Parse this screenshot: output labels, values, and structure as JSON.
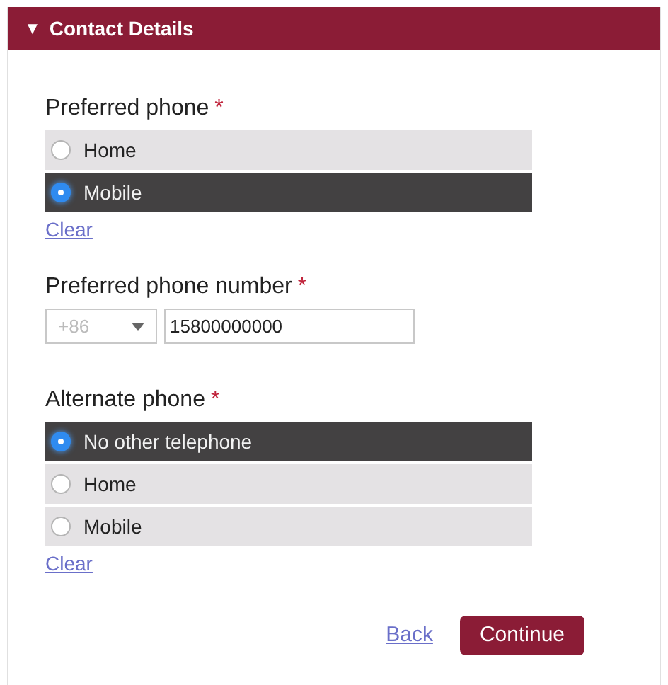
{
  "panel": {
    "toggle": "▼",
    "title": "Contact Details",
    "expanded": true
  },
  "preferred_phone": {
    "label": "Preferred phone",
    "required_mark": "*",
    "options": [
      {
        "label": "Home",
        "selected": false
      },
      {
        "label": "Mobile",
        "selected": true
      }
    ],
    "clear": "Clear"
  },
  "preferred_phone_number": {
    "label": "Preferred phone number",
    "required_mark": "*",
    "country_code": {
      "placeholder": "+86"
    },
    "number": {
      "value": "15800000000"
    }
  },
  "alternate_phone": {
    "label": "Alternate phone",
    "required_mark": "*",
    "options": [
      {
        "label": "No other telephone",
        "selected": true
      },
      {
        "label": "Home",
        "selected": false
      },
      {
        "label": "Mobile",
        "selected": false
      }
    ],
    "clear": "Clear"
  },
  "buttons": {
    "back": "Back",
    "continue": "Continue"
  }
}
